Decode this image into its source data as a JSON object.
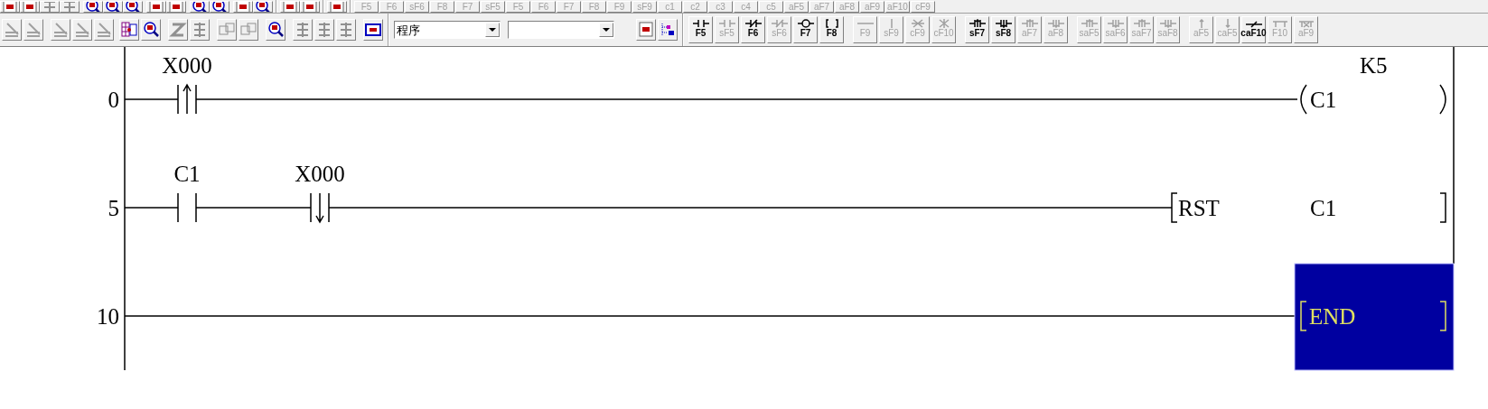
{
  "toolbar_top": {
    "keys": [
      {
        "label": "F5",
        "enabled": false
      },
      {
        "label": "F6",
        "enabled": false
      },
      {
        "label": "sF6",
        "enabled": false
      },
      {
        "label": "F8",
        "enabled": false
      },
      {
        "label": "F7",
        "enabled": false
      },
      {
        "label": "sF5",
        "enabled": false
      },
      {
        "label": "F5",
        "enabled": false
      },
      {
        "label": "F6",
        "enabled": false
      },
      {
        "label": "F7",
        "enabled": false
      },
      {
        "label": "F8",
        "enabled": false
      },
      {
        "label": "F9",
        "enabled": false
      },
      {
        "label": "sF9",
        "enabled": false
      },
      {
        "label": "c1",
        "enabled": false
      },
      {
        "label": "c2",
        "enabled": false
      },
      {
        "label": "c3",
        "enabled": false
      },
      {
        "label": "c4",
        "enabled": false
      },
      {
        "label": "c5",
        "enabled": false
      },
      {
        "label": "aF5",
        "enabled": false
      },
      {
        "label": "aF7",
        "enabled": false
      },
      {
        "label": "aF8",
        "enabled": false
      },
      {
        "label": "aF9",
        "enabled": false
      },
      {
        "label": "aF10",
        "enabled": false
      },
      {
        "label": "cF9",
        "enabled": false
      }
    ]
  },
  "toolbar": {
    "program_select": {
      "value": "程序"
    },
    "keys": [
      {
        "label": "F5",
        "enabled": true
      },
      {
        "label": "sF5",
        "enabled": false
      },
      {
        "label": "F6",
        "enabled": true
      },
      {
        "label": "sF6",
        "enabled": false
      },
      {
        "label": "F7",
        "enabled": true
      },
      {
        "label": "F8",
        "enabled": true
      },
      {
        "label": "F9",
        "enabled": false
      },
      {
        "label": "sF9",
        "enabled": false
      },
      {
        "label": "cF9",
        "enabled": false
      },
      {
        "label": "cF10",
        "enabled": false
      },
      {
        "label": "sF7",
        "enabled": true
      },
      {
        "label": "sF8",
        "enabled": true
      },
      {
        "label": "aF7",
        "enabled": false
      },
      {
        "label": "aF8",
        "enabled": false
      },
      {
        "label": "saF5",
        "enabled": false
      },
      {
        "label": "saF6",
        "enabled": false
      },
      {
        "label": "saF7",
        "enabled": false
      },
      {
        "label": "saF8",
        "enabled": false
      },
      {
        "label": "aF5",
        "enabled": false
      },
      {
        "label": "caF5",
        "enabled": false
      },
      {
        "label": "caF10",
        "enabled": true
      },
      {
        "label": "F10",
        "enabled": false
      },
      {
        "label": "aF9",
        "enabled": false
      }
    ]
  },
  "ladder": {
    "rungs": [
      {
        "step": "0",
        "elements": [
          {
            "kind": "rising_contact",
            "device": "X000"
          }
        ],
        "output": {
          "kind": "coil",
          "device": "C1",
          "constant": "K5"
        }
      },
      {
        "step": "5",
        "elements": [
          {
            "kind": "contact",
            "device": "C1"
          },
          {
            "kind": "falling_contact",
            "device": "X000"
          }
        ],
        "output": {
          "kind": "instruction",
          "instruction": "RST",
          "operand": "C1"
        }
      },
      {
        "step": "10",
        "output": {
          "kind": "end",
          "instruction": "END",
          "selected": true
        }
      }
    ]
  }
}
